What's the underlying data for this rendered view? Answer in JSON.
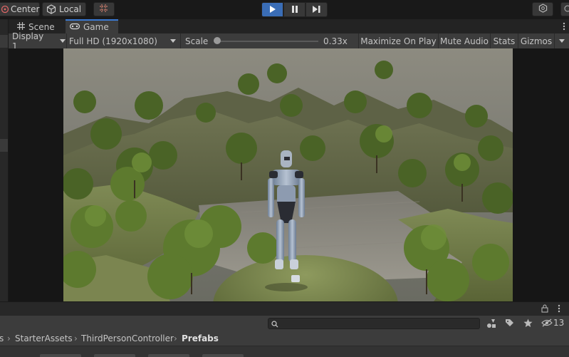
{
  "toolbar": {
    "pivot_center_label": "Center",
    "pivot_local_label": "Local"
  },
  "tabs": [
    {
      "label": "Scene",
      "icon": "grid-icon"
    },
    {
      "label": "Game",
      "icon": "gamepad-icon"
    }
  ],
  "game_toolbar": {
    "display": "Display 1",
    "resolution": "Full HD (1920x1080)",
    "scale_label": "Scale",
    "scale_value": "0.33x",
    "scale_fraction": 0.02,
    "maximize_on_play": "Maximize On Play",
    "mute_audio": "Mute Audio",
    "stats": "Stats",
    "gizmos": "Gizmos"
  },
  "project": {
    "hidden_count": "13",
    "breadcrumb": [
      "s",
      "StarterAssets",
      "ThirdPersonController",
      "Prefabs"
    ]
  },
  "colors": {
    "accent": "#3a79d1",
    "play_active": "#3a6db6"
  }
}
